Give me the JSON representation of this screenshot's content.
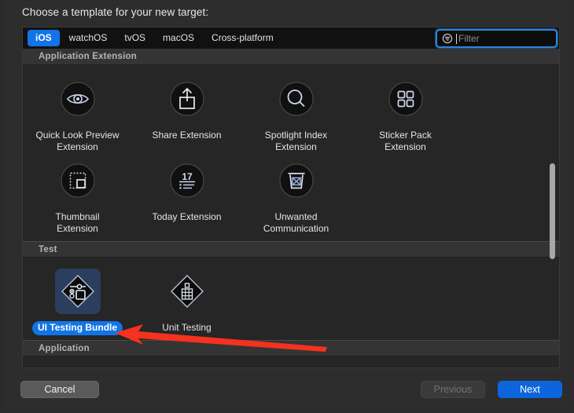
{
  "dialog": {
    "prompt": "Choose a template for your new target:"
  },
  "toolbar": {
    "tabs": [
      {
        "label": "iOS",
        "active": true
      },
      {
        "label": "watchOS",
        "active": false
      },
      {
        "label": "tvOS",
        "active": false
      },
      {
        "label": "macOS",
        "active": false
      },
      {
        "label": "Cross-platform",
        "active": false
      }
    ],
    "filter": {
      "placeholder": "Filter",
      "value": "",
      "icon": "filter-icon",
      "focused": true
    }
  },
  "sections": [
    {
      "title": "Application Extension",
      "items": [
        {
          "label": "Quick Look Preview Extension",
          "icon": "eye-icon",
          "selected": false
        },
        {
          "label": "Share Extension",
          "icon": "share-upload-icon",
          "selected": false
        },
        {
          "label": "Spotlight Index Extension",
          "icon": "magnifier-icon",
          "selected": false
        },
        {
          "label": "Sticker Pack Extension",
          "icon": "four-squares-icon",
          "selected": false
        },
        {
          "label": "Thumbnail Extension",
          "icon": "thumbnail-frame-icon",
          "selected": false
        },
        {
          "label": "Today Extension",
          "icon": "calendar-17-list-icon",
          "selected": false
        },
        {
          "label": "Unwanted Communication",
          "icon": "trash-x-icon",
          "selected": false
        }
      ]
    },
    {
      "title": "Test",
      "items": [
        {
          "label": "UI Testing Bundle",
          "icon": "diamond-slider-checkbox-icon",
          "selected": true
        },
        {
          "label": "Unit Testing",
          "icon": "diamond-grid-icon",
          "selected": false
        }
      ]
    },
    {
      "title": "Application",
      "items": []
    }
  ],
  "footer": {
    "cancel_label": "Cancel",
    "previous_label": "Previous",
    "previous_enabled": false,
    "next_label": "Next",
    "next_enabled": true
  },
  "annotation": {
    "type": "arrow",
    "color": "#f4321f",
    "direction": "left",
    "points_to": "UI Testing Bundle"
  },
  "colors": {
    "accent_blue": "#1274e8",
    "next_blue": "#0c65dd",
    "window_bg": "#2d2d2d",
    "panel_bg": "#262626",
    "section_header_bg": "#343434",
    "annotation_red": "#f4321f"
  },
  "scrollbar": {
    "visible": true,
    "orientation": "vertical"
  }
}
